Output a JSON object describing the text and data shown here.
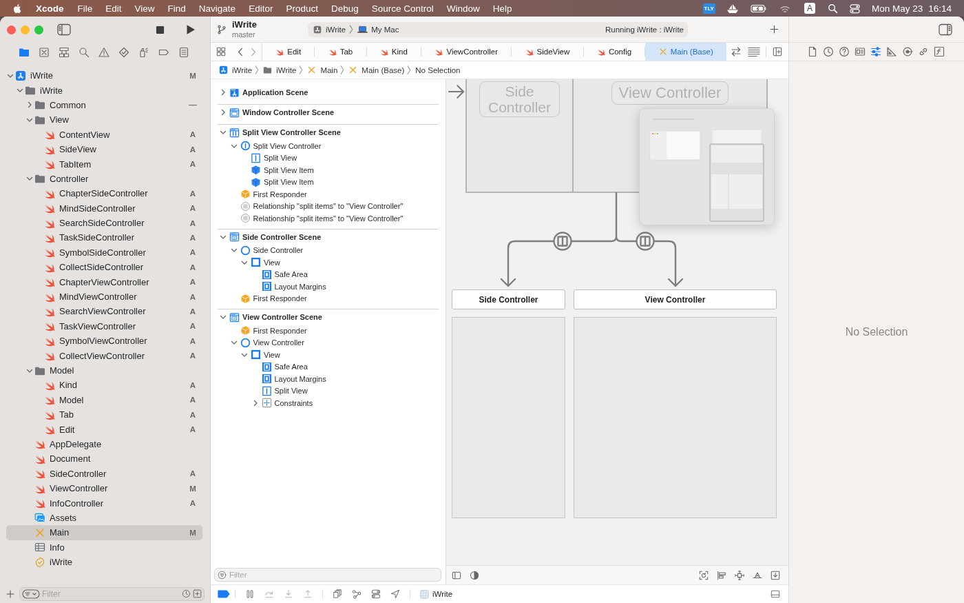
{
  "menu_bar": {
    "app_name": "Xcode",
    "menus": [
      "File",
      "Edit",
      "View",
      "Find",
      "Navigate",
      "Editor",
      "Product",
      "Debug",
      "Source Control",
      "Window",
      "Help"
    ],
    "tray_badge": "TLY",
    "input_source": "A",
    "clock": {
      "date": "Mon May 23",
      "time": "16:14"
    }
  },
  "toolbar": {
    "project": "iWrite",
    "branch": "master",
    "scheme": "iWrite",
    "destination": "My Mac",
    "status": "Running iWrite : iWrite"
  },
  "navigator": {
    "tabs": [
      {
        "selected": true
      },
      {
        "selected": false
      },
      {
        "selected": false
      },
      {
        "selected": false
      },
      {
        "selected": false
      },
      {
        "selected": false
      },
      {
        "selected": false
      },
      {
        "selected": false
      },
      {
        "selected": false
      }
    ],
    "files": [
      {
        "name": "iWrite",
        "kind": "project",
        "status": "M",
        "expanded": true,
        "selected": false,
        "children": [
          {
            "name": "iWrite",
            "kind": "folder",
            "expanded": true,
            "selected": false,
            "children": [
              {
                "name": "Common",
                "kind": "folder",
                "status": "—",
                "expanded": false,
                "selected": false
              },
              {
                "name": "View",
                "kind": "folder",
                "expanded": true,
                "selected": false,
                "children": [
                  {
                    "name": "ContentView",
                    "kind": "swift",
                    "status": "A",
                    "selected": false
                  },
                  {
                    "name": "SideView",
                    "kind": "swift",
                    "status": "A",
                    "selected": false
                  },
                  {
                    "name": "TabItem",
                    "kind": "swift",
                    "status": "A",
                    "selected": false
                  }
                ]
              },
              {
                "name": "Controller",
                "kind": "folder",
                "expanded": true,
                "selected": false,
                "children": [
                  {
                    "name": "ChapterSideController",
                    "kind": "swift",
                    "status": "A",
                    "selected": false
                  },
                  {
                    "name": "MindSideController",
                    "kind": "swift",
                    "status": "A",
                    "selected": false
                  },
                  {
                    "name": "SearchSideController",
                    "kind": "swift",
                    "status": "A",
                    "selected": false
                  },
                  {
                    "name": "TaskSideController",
                    "kind": "swift",
                    "status": "A",
                    "selected": false
                  },
                  {
                    "name": "SymbolSideController",
                    "kind": "swift",
                    "status": "A",
                    "selected": false
                  },
                  {
                    "name": "CollectSideController",
                    "kind": "swift",
                    "status": "A",
                    "selected": false
                  },
                  {
                    "name": "ChapterViewController",
                    "kind": "swift",
                    "status": "A",
                    "selected": false
                  },
                  {
                    "name": "MindViewController",
                    "kind": "swift",
                    "status": "A",
                    "selected": false
                  },
                  {
                    "name": "SearchViewController",
                    "kind": "swift",
                    "status": "A",
                    "selected": false
                  },
                  {
                    "name": "TaskViewController",
                    "kind": "swift",
                    "status": "A",
                    "selected": false
                  },
                  {
                    "name": "SymbolViewController",
                    "kind": "swift",
                    "status": "A",
                    "selected": false
                  },
                  {
                    "name": "CollectViewController",
                    "kind": "swift",
                    "status": "A",
                    "selected": false
                  }
                ]
              },
              {
                "name": "Model",
                "kind": "folder",
                "expanded": true,
                "selected": false,
                "children": [
                  {
                    "name": "Kind",
                    "kind": "swift",
                    "status": "A",
                    "selected": false
                  },
                  {
                    "name": "Model",
                    "kind": "swift",
                    "status": "A",
                    "selected": false
                  },
                  {
                    "name": "Tab",
                    "kind": "swift",
                    "status": "A",
                    "selected": false
                  },
                  {
                    "name": "Edit",
                    "kind": "swift",
                    "status": "A",
                    "selected": false
                  }
                ]
              },
              {
                "name": "AppDelegate",
                "kind": "swift",
                "selected": false
              },
              {
                "name": "Document",
                "kind": "swift",
                "selected": false
              },
              {
                "name": "SideController",
                "kind": "swift",
                "status": "A",
                "selected": false
              },
              {
                "name": "ViewController",
                "kind": "swift",
                "status": "M",
                "selected": false
              },
              {
                "name": "InfoController",
                "kind": "swift",
                "status": "A",
                "selected": false
              },
              {
                "name": "Assets",
                "kind": "assets",
                "selected": false
              },
              {
                "name": "Main",
                "kind": "storyboard",
                "status": "M",
                "selected": true
              },
              {
                "name": "Info",
                "kind": "plist",
                "selected": false
              },
              {
                "name": "iWrite",
                "kind": "entitlements",
                "selected": false
              }
            ]
          }
        ]
      }
    ],
    "filter": {
      "placeholder": "Filter"
    }
  },
  "editor": {
    "tabs": [
      {
        "label": "Edit",
        "kind": "swift",
        "selected": false
      },
      {
        "label": "Tab",
        "kind": "swift",
        "selected": false
      },
      {
        "label": "Kind",
        "kind": "swift",
        "selected": false
      },
      {
        "label": "ViewController",
        "kind": "swift",
        "selected": false
      },
      {
        "label": "SideView",
        "kind": "swift",
        "selected": false
      },
      {
        "label": "Config",
        "kind": "swift",
        "selected": false
      },
      {
        "label": "Main (Base)",
        "kind": "storyboard",
        "selected": true
      }
    ],
    "jump_bar": [
      {
        "label": "iWrite",
        "kind": "project"
      },
      {
        "label": "iWrite",
        "kind": "folder"
      },
      {
        "label": "Main",
        "kind": "storyboard"
      },
      {
        "label": "Main (Base)",
        "kind": "storyboard"
      },
      {
        "label": "No Selection"
      }
    ],
    "outline": {
      "scenes": [
        {
          "title": "Application Scene",
          "kind": "application",
          "expanded": false,
          "selected": false
        },
        {
          "title": "Window Controller Scene",
          "kind": "window",
          "expanded": false,
          "selected": false
        },
        {
          "title": "Split View Controller Scene",
          "kind": "split",
          "expanded": true,
          "selected": false,
          "children": [
            {
              "label": "Split View Controller",
              "kind": "split-controller",
              "expanded": true,
              "selected": false,
              "children": [
                {
                  "label": "Split View",
                  "kind": "split-view",
                  "selected": false
                },
                {
                  "label": "Split View Item",
                  "kind": "split-item",
                  "selected": false
                },
                {
                  "label": "Split View Item",
                  "kind": "split-item",
                  "selected": false
                }
              ]
            },
            {
              "label": "First Responder",
              "kind": "responder",
              "selected": false
            },
            {
              "label": "Relationship \"split items\" to \"View Controller\"",
              "kind": "relationship",
              "selected": false
            },
            {
              "label": "Relationship \"split items\" to \"View Controller\"",
              "kind": "relationship",
              "selected": false
            }
          ]
        },
        {
          "title": "Side Controller Scene",
          "kind": "controller",
          "expanded": true,
          "selected": false,
          "children": [
            {
              "label": "Side Controller",
              "kind": "controller",
              "expanded": true,
              "selected": false,
              "children": [
                {
                  "label": "View",
                  "kind": "view",
                  "expanded": true,
                  "selected": false,
                  "children": [
                    {
                      "label": "Safe Area",
                      "kind": "guide",
                      "selected": false
                    },
                    {
                      "label": "Layout Margins",
                      "kind": "guide",
                      "selected": false
                    }
                  ]
                }
              ]
            },
            {
              "label": "First Responder",
              "kind": "responder",
              "selected": false
            }
          ]
        },
        {
          "title": "View Controller Scene",
          "kind": "controller",
          "expanded": true,
          "selected": false,
          "children": [
            {
              "label": "First Responder",
              "kind": "responder",
              "selected": false
            },
            {
              "label": "View Controller",
              "kind": "controller",
              "expanded": true,
              "selected": false,
              "children": [
                {
                  "label": "View",
                  "kind": "view",
                  "expanded": true,
                  "selected": false,
                  "children": [
                    {
                      "label": "Safe Area",
                      "kind": "guide",
                      "selected": false
                    },
                    {
                      "label": "Layout Margins",
                      "kind": "guide",
                      "selected": false
                    },
                    {
                      "label": "Split View",
                      "kind": "split-view",
                      "selected": false
                    },
                    {
                      "label": "Constraints",
                      "kind": "constraints",
                      "expanded": false,
                      "selected": false
                    }
                  ]
                }
              ]
            }
          ]
        }
      ],
      "filter": {
        "placeholder": "Filter"
      }
    },
    "canvas": {
      "split_scene": {
        "placeholders": [
          "Side Controller",
          "View Controller"
        ]
      },
      "scenes": [
        {
          "title": "Side Controller"
        },
        {
          "title": "View Controller"
        }
      ]
    }
  },
  "debug_bar": {
    "breakpoints_active": true,
    "process": "iWrite"
  },
  "inspector": {
    "tabs": [
      {
        "selected": false
      },
      {
        "selected": false
      },
      {
        "selected": false
      },
      {
        "selected": false
      },
      {
        "selected": true
      },
      {
        "selected": false
      },
      {
        "selected": false
      },
      {
        "selected": false
      },
      {
        "selected": false
      }
    ],
    "message": "No Selection"
  }
}
